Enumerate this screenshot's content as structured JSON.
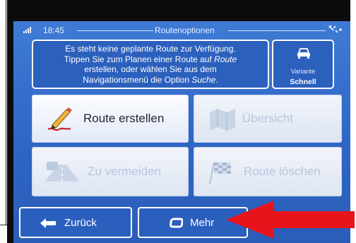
{
  "status_bar": {
    "time": "18:45",
    "title": "Routenoptionen",
    "signal_icon": "signal-icon",
    "gps_icon": "satellite-icon"
  },
  "info": {
    "line1": "Es steht keine geplante Route zur Verfügung.",
    "line2a": "Tippen Sie zum Planen einer Route auf ",
    "line2b": "Route",
    "line3": "erstellen, oder wählen Sie aus dem",
    "line4a": "Navigationsmenü die Option ",
    "line4b": "Suche",
    "line4c": "."
  },
  "variant": {
    "icon": "car-icon",
    "label": "Variante",
    "value": "Schnell"
  },
  "buttons": {
    "create_route": "Route erstellen",
    "overview": "Übersicht",
    "avoid": "Zu vermeiden",
    "delete_route": "Route löschen"
  },
  "bottom": {
    "back": "Zurück",
    "more": "Mehr"
  },
  "colors": {
    "screen_bg": "#2f66c5",
    "button_bg": "#eef2fa",
    "disabled_text": "#b8c6dd",
    "annotation_arrow": "#e8141c"
  }
}
